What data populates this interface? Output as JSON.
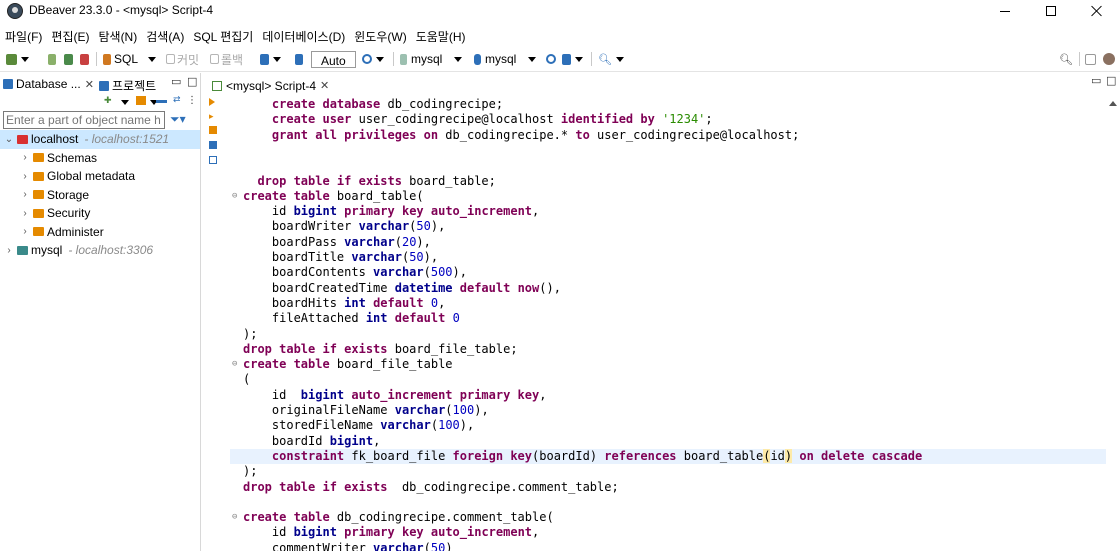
{
  "window": {
    "title": "DBeaver 23.3.0 - <mysql> Script-4"
  },
  "menu": [
    "파일(F)",
    "편집(E)",
    "탐색(N)",
    "검색(A)",
    "SQL 편집기",
    "데이터베이스(D)",
    "윈도우(W)",
    "도움말(H)"
  ],
  "toolbar": {
    "sql_label": "SQL",
    "commit_label": "커밋",
    "rollback_label": "롤백",
    "auto_label": "Auto",
    "datasource_label": "mysql",
    "schema_label": "mysql"
  },
  "navigator": {
    "tab_database": "Database ...",
    "tab_projects": "프로젝트",
    "filter_placeholder": "Enter a part of object name h",
    "tree": [
      {
        "label": "localhost",
        "host": "- localhost:1521",
        "level": 0,
        "expanded": true,
        "selected": true,
        "icon": "oracle-connection-icon",
        "color": "#d83030"
      },
      {
        "label": "Schemas",
        "host": "",
        "level": 1,
        "expanded": false,
        "selected": false,
        "icon": "schemas-folder-icon",
        "color": "#e58a00"
      },
      {
        "label": "Global metadata",
        "host": "",
        "level": 1,
        "expanded": false,
        "selected": false,
        "icon": "folder-icon",
        "color": "#e58a00"
      },
      {
        "label": "Storage",
        "host": "",
        "level": 1,
        "expanded": false,
        "selected": false,
        "icon": "folder-icon",
        "color": "#e58a00"
      },
      {
        "label": "Security",
        "host": "",
        "level": 1,
        "expanded": false,
        "selected": false,
        "icon": "folder-icon",
        "color": "#e58a00"
      },
      {
        "label": "Administer",
        "host": "",
        "level": 1,
        "expanded": false,
        "selected": false,
        "icon": "admin-folder-icon",
        "color": "#e58a00"
      },
      {
        "label": "mysql",
        "host": "- localhost:3306",
        "level": 0,
        "expanded": false,
        "selected": false,
        "icon": "mysql-connection-icon",
        "color": "#3a8a8a"
      }
    ]
  },
  "editor": {
    "tab_title": "<mysql> Script-4",
    "lines": [
      [
        [
          "    ",
          ""
        ],
        [
          "create database",
          "kw"
        ],
        [
          " db_codingrecipe;",
          ""
        ]
      ],
      [
        [
          "    ",
          ""
        ],
        [
          "create user",
          "kw"
        ],
        [
          " user_codingrecipe@localhost ",
          ""
        ],
        [
          "identified by",
          "kw"
        ],
        [
          " ",
          ""
        ],
        [
          "'1234'",
          "str"
        ],
        [
          ";",
          ""
        ]
      ],
      [
        [
          "    ",
          ""
        ],
        [
          "grant all privileges on",
          "kw"
        ],
        [
          " db_codingrecipe.* ",
          ""
        ],
        [
          "to",
          "kw"
        ],
        [
          " user_codingrecipe@localhost;",
          ""
        ]
      ],
      [],
      [],
      [
        [
          "  ",
          ""
        ],
        [
          "drop table if exists",
          "kw"
        ],
        [
          " board_table;",
          ""
        ]
      ],
      [
        [
          "create table",
          "kw"
        ],
        [
          " board_table(",
          ""
        ]
      ],
      [
        [
          "    id ",
          ""
        ],
        [
          "bigint",
          "ty"
        ],
        [
          " ",
          ""
        ],
        [
          "primary key auto_increment",
          "kw"
        ],
        [
          ",",
          ""
        ]
      ],
      [
        [
          "    boardWriter ",
          ""
        ],
        [
          "varchar",
          "ty"
        ],
        [
          "(",
          ""
        ],
        [
          "50",
          "num"
        ],
        [
          "),",
          ""
        ]
      ],
      [
        [
          "    boardPass ",
          ""
        ],
        [
          "varchar",
          "ty"
        ],
        [
          "(",
          ""
        ],
        [
          "20",
          "num"
        ],
        [
          "),",
          ""
        ]
      ],
      [
        [
          "    boardTitle ",
          ""
        ],
        [
          "varchar",
          "ty"
        ],
        [
          "(",
          ""
        ],
        [
          "50",
          "num"
        ],
        [
          "),",
          ""
        ]
      ],
      [
        [
          "    boardContents ",
          ""
        ],
        [
          "varchar",
          "ty"
        ],
        [
          "(",
          ""
        ],
        [
          "500",
          "num"
        ],
        [
          "),",
          ""
        ]
      ],
      [
        [
          "    boardCreatedTime ",
          ""
        ],
        [
          "datetime",
          "ty"
        ],
        [
          " ",
          ""
        ],
        [
          "default",
          "kw"
        ],
        [
          " ",
          ""
        ],
        [
          "now",
          "kw"
        ],
        [
          "(),",
          ""
        ]
      ],
      [
        [
          "    boardHits ",
          ""
        ],
        [
          "int",
          "ty"
        ],
        [
          " ",
          ""
        ],
        [
          "default",
          "kw"
        ],
        [
          " ",
          ""
        ],
        [
          "0",
          "num"
        ],
        [
          ",",
          ""
        ]
      ],
      [
        [
          "    fileAttached ",
          ""
        ],
        [
          "int",
          "ty"
        ],
        [
          " ",
          ""
        ],
        [
          "default",
          "kw"
        ],
        [
          " ",
          ""
        ],
        [
          "0",
          "num"
        ]
      ],
      [
        [
          ");",
          ""
        ]
      ],
      [
        [
          "drop table if exists",
          "kw"
        ],
        [
          " board_file_table;",
          ""
        ]
      ],
      [
        [
          "create table",
          "kw"
        ],
        [
          " board_file_table",
          ""
        ]
      ],
      [
        [
          "(",
          ""
        ]
      ],
      [
        [
          "    id  ",
          ""
        ],
        [
          "bigint",
          "ty"
        ],
        [
          " ",
          ""
        ],
        [
          "auto_increment primary key",
          "kw"
        ],
        [
          ",",
          ""
        ]
      ],
      [
        [
          "    originalFileName ",
          ""
        ],
        [
          "varchar",
          "ty"
        ],
        [
          "(",
          ""
        ],
        [
          "100",
          "num"
        ],
        [
          "),",
          ""
        ]
      ],
      [
        [
          "    storedFileName ",
          ""
        ],
        [
          "varchar",
          "ty"
        ],
        [
          "(",
          ""
        ],
        [
          "100",
          "num"
        ],
        [
          "),",
          ""
        ]
      ],
      [
        [
          "    boardId ",
          ""
        ],
        [
          "bigint",
          "ty"
        ],
        [
          ",",
          ""
        ]
      ],
      [
        [
          "    ",
          ""
        ],
        [
          "constraint",
          "kw"
        ],
        [
          " fk_board_file ",
          ""
        ],
        [
          "foreign key",
          "kw"
        ],
        [
          "(boardId) ",
          ""
        ],
        [
          "references",
          "kw"
        ],
        [
          " board_table",
          ""
        ],
        [
          "(",
          "hl"
        ],
        [
          "id",
          ""
        ],
        [
          ")",
          "hl"
        ],
        [
          " ",
          ""
        ],
        [
          "on delete cascade",
          "kw"
        ]
      ],
      [
        [
          ");",
          ""
        ]
      ],
      [
        [
          "drop table if exists",
          "kw"
        ],
        [
          "  db_codingrecipe.comment_table;",
          ""
        ]
      ],
      [],
      [
        [
          "create table",
          "kw"
        ],
        [
          " db_codingrecipe.comment_table(",
          ""
        ]
      ],
      [
        [
          "    id ",
          ""
        ],
        [
          "bigint",
          "ty"
        ],
        [
          " ",
          ""
        ],
        [
          "primary key auto_increment",
          "kw"
        ],
        [
          ",",
          ""
        ]
      ],
      [
        [
          "    commentWriter ",
          ""
        ],
        [
          "varchar",
          "ty"
        ],
        [
          "(",
          ""
        ],
        [
          "50",
          "num"
        ],
        [
          ")",
          ""
        ]
      ]
    ],
    "current_line": 23,
    "fold_lines": [
      6,
      17,
      27
    ]
  }
}
